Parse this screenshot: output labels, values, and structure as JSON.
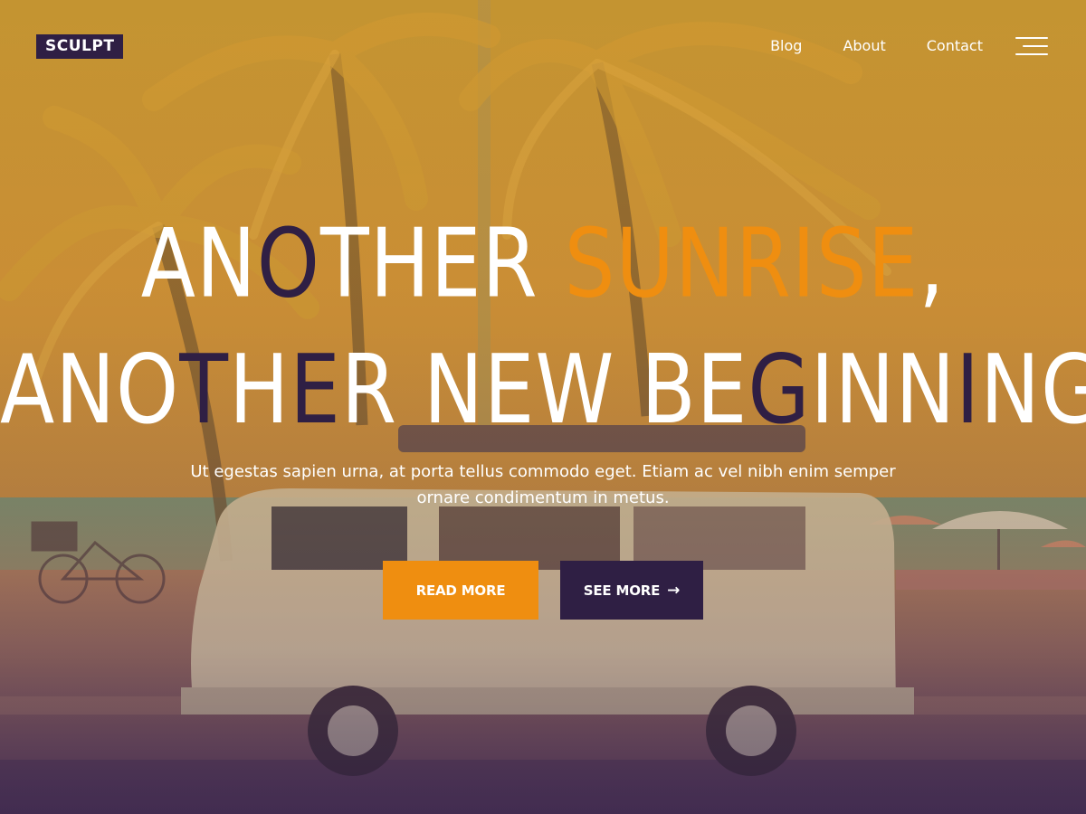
{
  "brand": {
    "logo": "SCULPT"
  },
  "nav": {
    "items": [
      "Blog",
      "About",
      "Contact"
    ]
  },
  "hero": {
    "headline_line1": [
      {
        "text": "AN",
        "color": "#ffffff"
      },
      {
        "text": "O",
        "color": "#2f1f44"
      },
      {
        "text": "THER ",
        "color": "#ffffff"
      },
      {
        "text": "SUNRISE",
        "color": "#ef8e10"
      },
      {
        "text": ",",
        "color": "#ffffff"
      }
    ],
    "headline_line2": [
      {
        "text": "ANO",
        "color": "#ffffff"
      },
      {
        "text": "T",
        "color": "#2f1f44"
      },
      {
        "text": "H",
        "color": "#ffffff"
      },
      {
        "text": "E",
        "color": "#2f1f44"
      },
      {
        "text": "R NEW BE",
        "color": "#ffffff"
      },
      {
        "text": "G",
        "color": "#2f1f44"
      },
      {
        "text": "INN",
        "color": "#ffffff"
      },
      {
        "text": "I",
        "color": "#2f1f44"
      },
      {
        "text": "NG!",
        "color": "#ffffff"
      }
    ],
    "subtitle": "Ut egestas sapien urna, at porta tellus commodo eget. Etiam ac vel nibh enim semper ornare condimentum in metus.",
    "buttons": {
      "read_more": "READ MORE",
      "see_more": "SEE MORE",
      "see_more_icon": "arrow-right-icon"
    }
  },
  "colors": {
    "accent": "#ef8e10",
    "brand_dark": "#2f1f44"
  }
}
